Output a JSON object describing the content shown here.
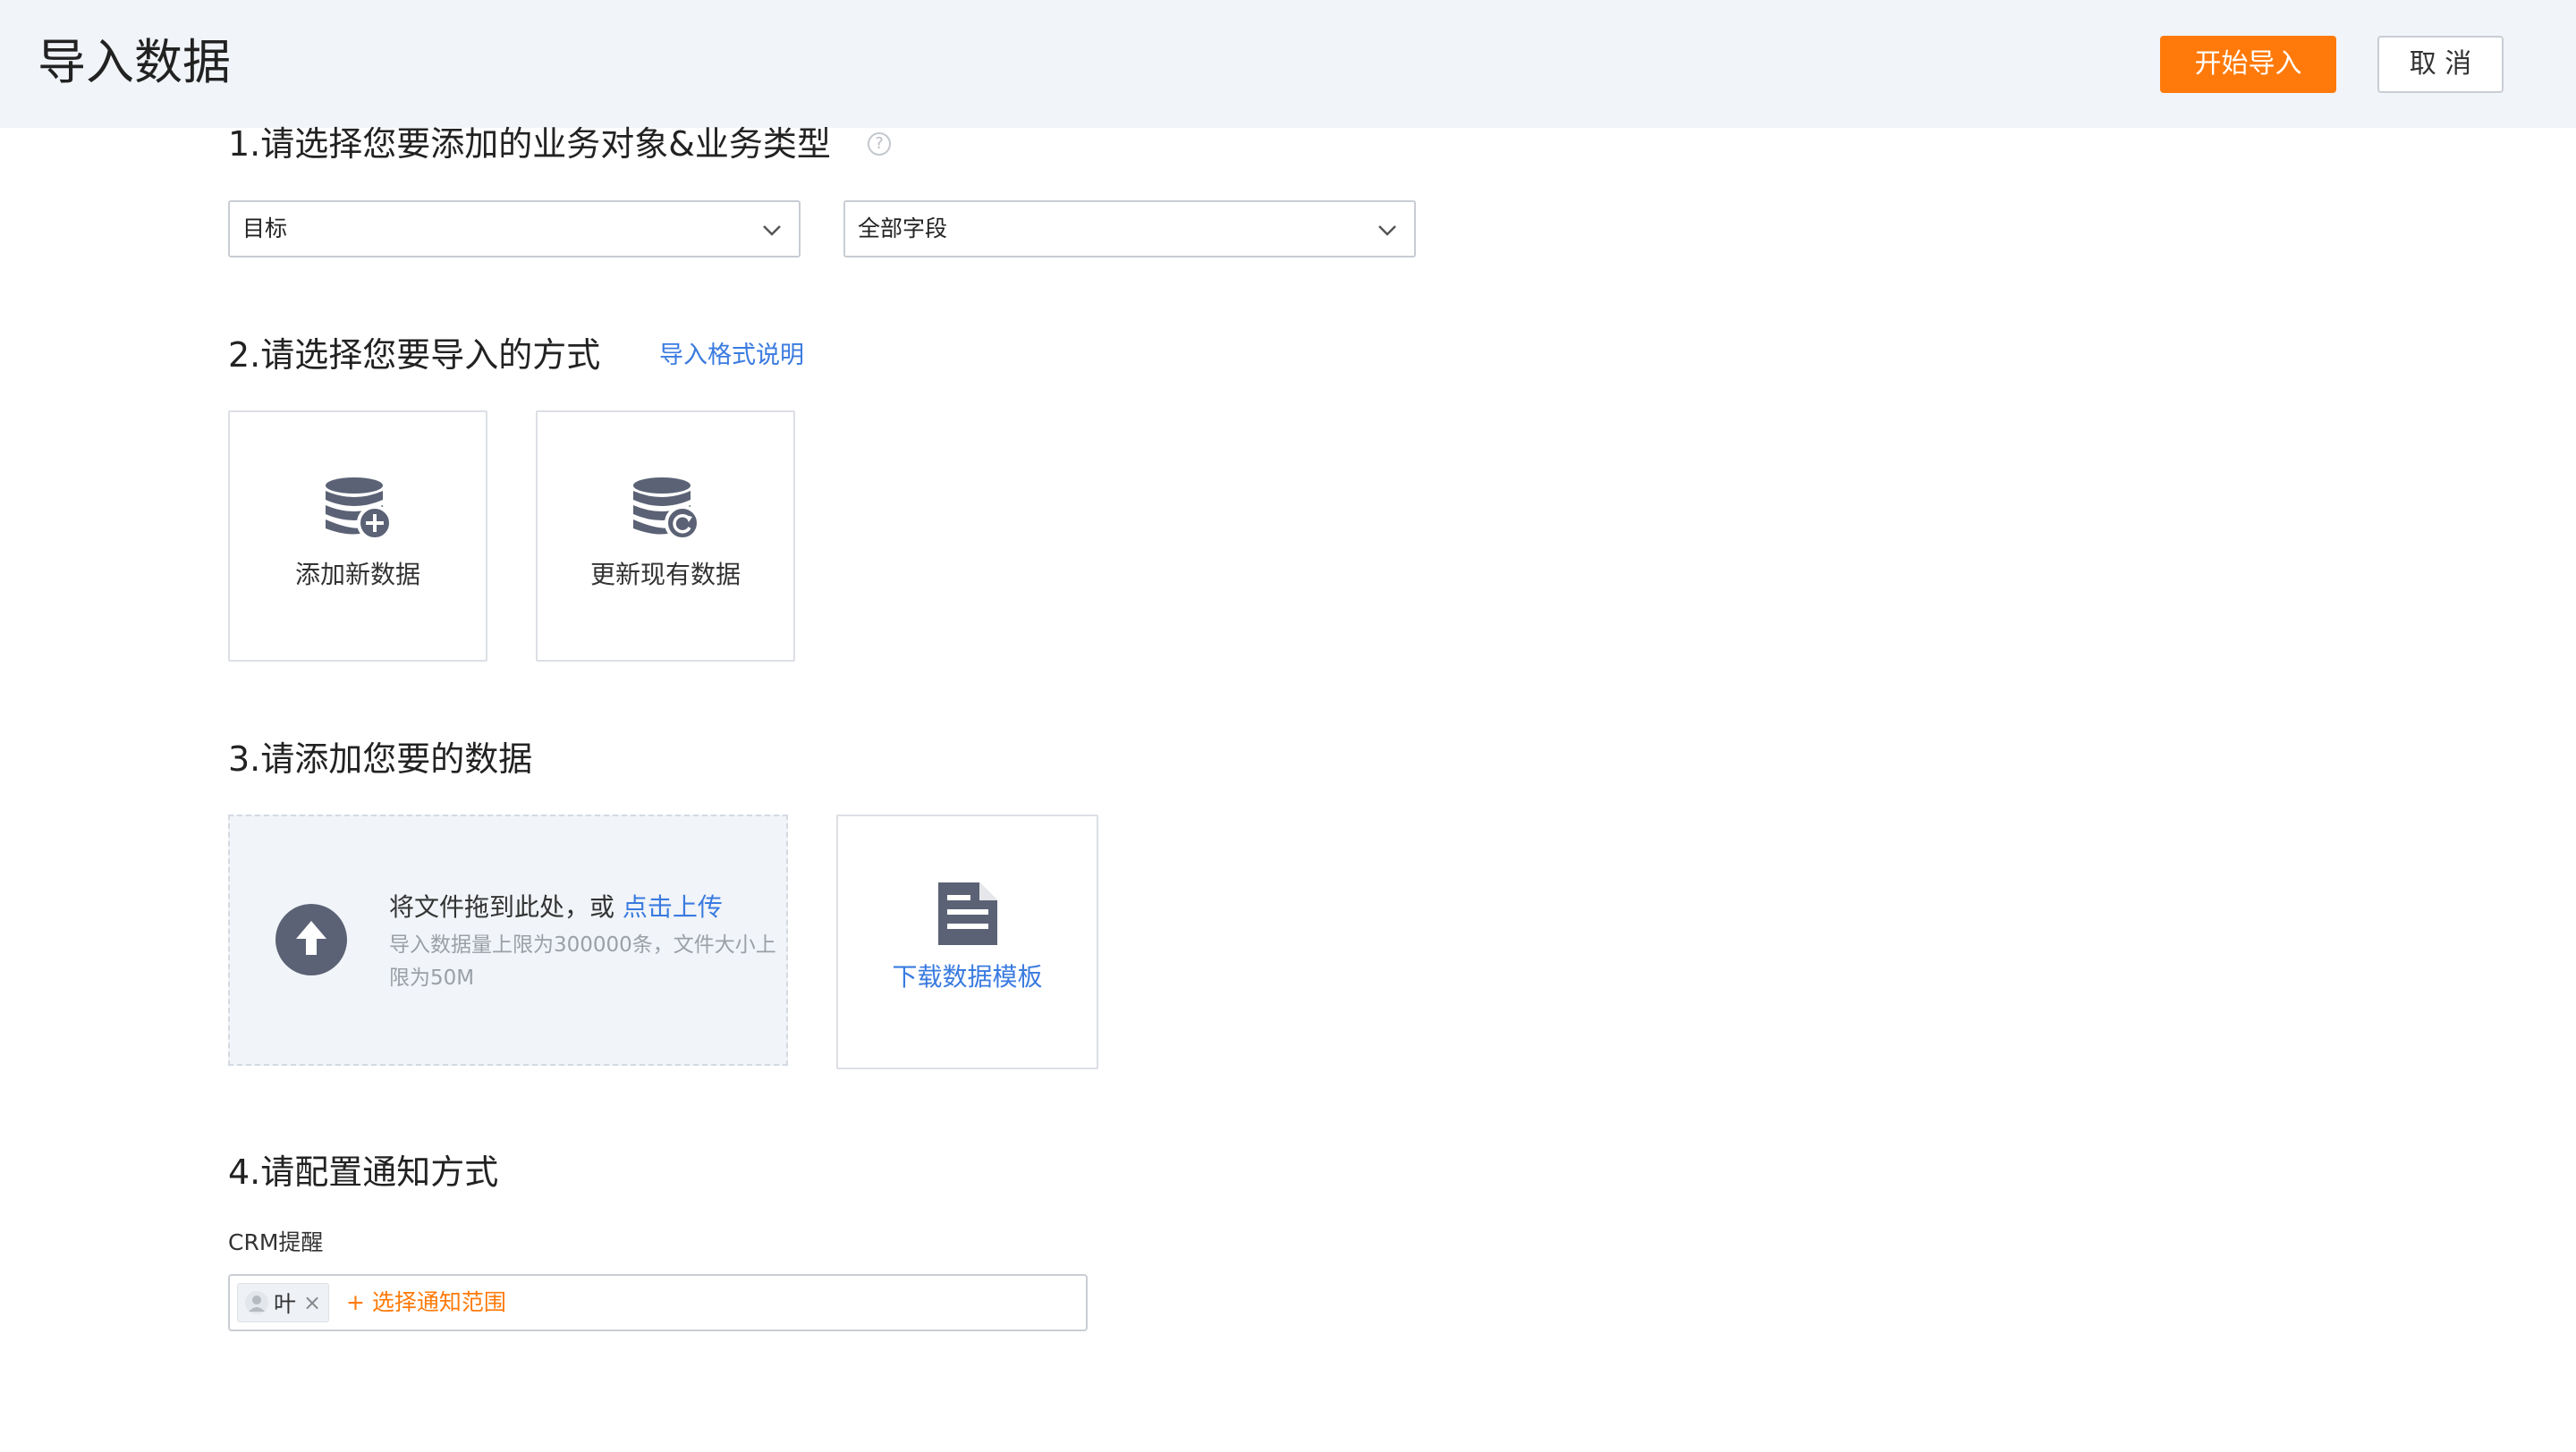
{
  "header": {
    "title": "导入数据",
    "start_import_label": "开始导入",
    "cancel_label": "取 消",
    "accent_color": "#ff7a0a"
  },
  "step1": {
    "title": "1.请选择您要添加的业务对象&业务类型",
    "help_icon": "question-circle-icon",
    "object_select": {
      "value": "目标"
    },
    "type_select": {
      "value": "全部字段"
    }
  },
  "step2": {
    "title": "2.请选择您要导入的方式",
    "format_link": "导入格式说明",
    "options": [
      {
        "label": "添加新数据",
        "icon": "database-add-icon"
      },
      {
        "label": "更新现有数据",
        "icon": "database-refresh-icon"
      }
    ]
  },
  "step3": {
    "title": "3.请添加您要的数据",
    "upload": {
      "prompt": "将文件拖到此处，或 ",
      "link": "点击上传",
      "hint": "导入数据量上限为300000条，文件大小上限为50M",
      "icon": "upload-arrow-icon"
    },
    "download": {
      "label": "下载数据模板",
      "icon": "document-icon"
    }
  },
  "step4": {
    "title": "4.请配置通知方式",
    "field_label": "CRM提醒",
    "recipients": [
      {
        "name": "叶"
      }
    ],
    "add_label": "+ 选择通知范围"
  }
}
